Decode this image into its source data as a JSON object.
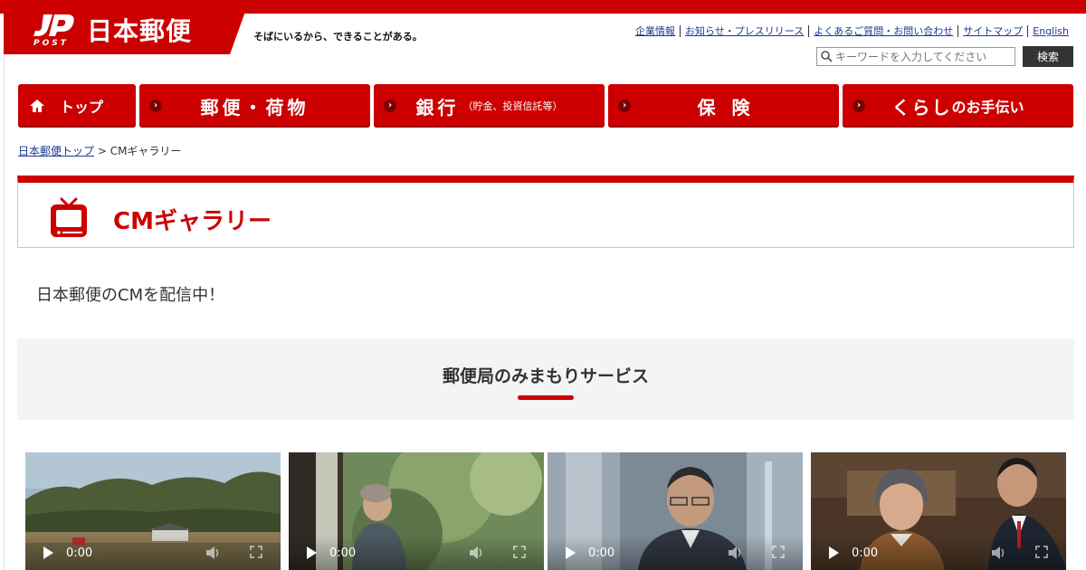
{
  "header": {
    "logo_text": "日本郵便",
    "logo_mark_text": "JP POST",
    "tagline": "そばにいるから、できることがある。",
    "util_links": [
      "企業情報",
      "お知らせ・プレスリリース",
      "よくあるご質問・お問い合わせ",
      "サイトマップ",
      "English"
    ],
    "search_placeholder": "キーワードを入力してください",
    "search_button": "検索"
  },
  "nav": {
    "home": "トップ",
    "items": [
      {
        "label": "郵便・荷物",
        "sub": ""
      },
      {
        "label": "銀行",
        "sub": "（貯金、投資信託等）"
      },
      {
        "label": "保険",
        "sub": ""
      },
      {
        "label_main": "くらし",
        "label_small": "のお手伝い"
      }
    ]
  },
  "breadcrumb": {
    "home": "日本郵便トップ",
    "separator": " > ",
    "current": "CMギャラリー"
  },
  "page": {
    "title": "CMギャラリー",
    "intro": "日本郵便のCMを配信中！"
  },
  "section": {
    "title": "郵便局のみまもりサービス"
  },
  "videos": [
    {
      "time": "0:00",
      "scene": "rural-landscape"
    },
    {
      "time": "0:00",
      "scene": "elderly-woman-window"
    },
    {
      "time": "0:00",
      "scene": "businessman-phone"
    },
    {
      "time": "0:00",
      "scene": "woman-with-postal-staff"
    }
  ],
  "colors": {
    "brand_red": "#cc0000",
    "link_blue": "#1a3c8e",
    "dark_button": "#333333"
  }
}
